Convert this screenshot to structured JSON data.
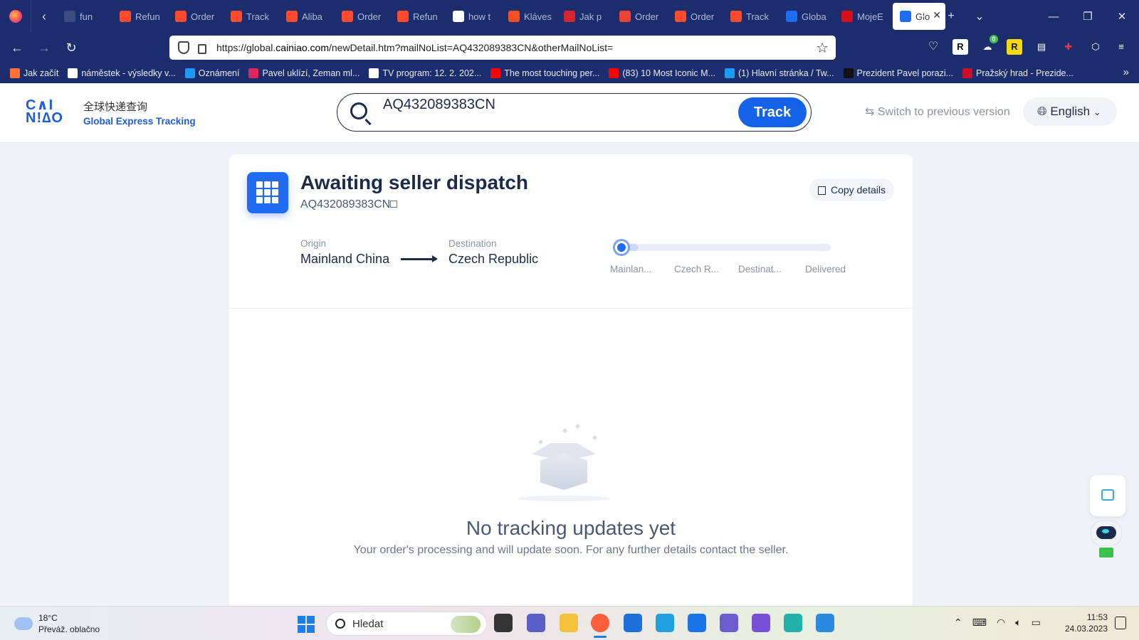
{
  "browser": {
    "tabs": [
      {
        "label": "fun",
        "color": "#3c4b80"
      },
      {
        "label": "Refun",
        "color": "#ff4b2b"
      },
      {
        "label": "Order",
        "color": "#ff4b2b"
      },
      {
        "label": "Track",
        "color": "#ff4b2b"
      },
      {
        "label": "Aliba",
        "color": "#ff4b2b"
      },
      {
        "label": "Order",
        "color": "#ff4b2b"
      },
      {
        "label": "Refun",
        "color": "#ff4b2b"
      },
      {
        "label": "how t",
        "color": "#ffffff"
      },
      {
        "label": "Kláves",
        "color": "#f25022"
      },
      {
        "label": "Jak p",
        "color": "#d9232e"
      },
      {
        "label": "Order",
        "color": "#ea4335"
      },
      {
        "label": "Order",
        "color": "#ff4b2b"
      },
      {
        "label": "Track",
        "color": "#ff4b2b"
      },
      {
        "label": "Globa",
        "color": "#1f6bf2"
      },
      {
        "label": "MojeE",
        "color": "#d4101b"
      }
    ],
    "active_tab": {
      "label": "Glo",
      "color": "#1f6bf2"
    },
    "url_prefix": "https://global.",
    "url_domain": "cainiao.com",
    "url_suffix": "/newDetail.htm?mailNoList=AQ432089383CN&otherMailNoList=",
    "bookmarks": [
      {
        "label": "Jak začít",
        "color": "#ff7139"
      },
      {
        "label": "náměstek - výsledky v...",
        "color": "#ffffff"
      },
      {
        "label": "Oznámení",
        "color": "#1d9bf0"
      },
      {
        "label": "Pavel uklízí, Zeman ml...",
        "color": "#e0245e"
      },
      {
        "label": "TV program: 12. 2. 202...",
        "color": "#ffffff"
      },
      {
        "label": "The most touching per...",
        "color": "#ff0000"
      },
      {
        "label": "(83) 10 Most Iconic M...",
        "color": "#ff0000"
      },
      {
        "label": "(1) Hlavní stránka / Tw...",
        "color": "#1d9bf0"
      },
      {
        "label": "Prezident Pavel porazi...",
        "color": "#111111"
      },
      {
        "label": "Pražský hrad - Prezide...",
        "color": "#c8102e"
      }
    ],
    "ext_badge": "0"
  },
  "site": {
    "logo_text": "CAI NIAO",
    "logo_cn": "全球快递查询",
    "logo_en": "Global Express Tracking",
    "search_value": "AQ432089383CN",
    "track_label": "Track",
    "switch_label": "⇆ Switch to previous version",
    "language": "English"
  },
  "shipment": {
    "status": "Awaiting seller dispatch",
    "tracking_number": "AQ432089383CN",
    "copy_label": "Copy details",
    "origin_label": "Origin",
    "origin": "Mainland China",
    "destination_label": "Destination",
    "destination": "Czech Republic",
    "progress_fraction": 0.1,
    "stages": [
      "Mainlan...",
      "Czech R...",
      "Destinat...",
      "Delivered"
    ],
    "empty_title": "No tracking updates yet",
    "empty_subtitle": "Your order's processing and will update soon. For any further details contact the seller."
  },
  "taskbar": {
    "weather_temp": "18°C",
    "weather_desc": "Převáž. oblačno",
    "search_placeholder": "Hledat",
    "time": "11:53",
    "date": "24.03.2023",
    "apps": [
      {
        "name": "task-view-icon",
        "color": "#333333"
      },
      {
        "name": "teams-chat-icon",
        "color": "#5b5fc7"
      },
      {
        "name": "file-explorer-icon",
        "color": "#f6c23e"
      },
      {
        "name": "firefox-icon",
        "color": "#ff5e3a"
      },
      {
        "name": "ms-store-icon",
        "color": "#1e6fd9"
      },
      {
        "name": "l-app-icon",
        "color": "#1fa0e0"
      },
      {
        "name": "mail-icon",
        "color": "#1a73e8"
      },
      {
        "name": "app-purple-icon",
        "color": "#6d5bd0"
      },
      {
        "name": "app-violet-icon",
        "color": "#7a4fd8"
      },
      {
        "name": "edge-icon",
        "color": "#1fb2a8"
      },
      {
        "name": "photos-icon",
        "color": "#2a8ae0"
      }
    ]
  }
}
